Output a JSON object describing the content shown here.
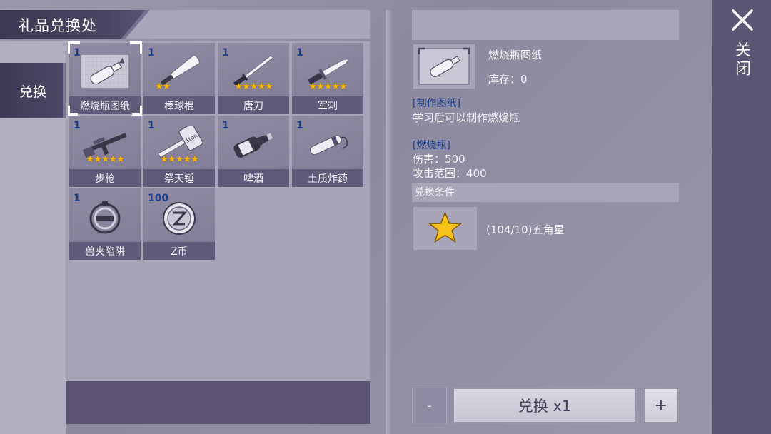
{
  "header": {
    "title": "礼品兑换处"
  },
  "tabs": [
    {
      "label": "兑换"
    }
  ],
  "items": [
    {
      "name": "燃烧瓶图纸",
      "count": "1",
      "stars": "",
      "icon": "blueprint-icon"
    },
    {
      "name": "棒球棍",
      "count": "1",
      "stars": "★★",
      "icon": "baseball-bat-icon"
    },
    {
      "name": "唐刀",
      "count": "1",
      "stars": "★★★★★",
      "icon": "tang-sword-icon"
    },
    {
      "name": "军刺",
      "count": "1",
      "stars": "★★★★★",
      "icon": "bayonet-icon"
    },
    {
      "name": "步枪",
      "count": "1",
      "stars": "★★★★★",
      "icon": "rifle-icon"
    },
    {
      "name": "祭天锤",
      "count": "1",
      "stars": "★★★★★",
      "icon": "hammer-icon"
    },
    {
      "name": "啤酒",
      "count": "1",
      "stars": "",
      "icon": "beer-bottle-icon"
    },
    {
      "name": "土质炸药",
      "count": "1",
      "stars": "",
      "icon": "dynamite-icon"
    },
    {
      "name": "兽夹陷阱",
      "count": "1",
      "stars": "",
      "icon": "bear-trap-icon"
    },
    {
      "name": "Z币",
      "count": "100",
      "stars": "",
      "icon": "z-coin-icon"
    }
  ],
  "detail": {
    "name": "燃烧瓶图纸",
    "stock": "库存：0",
    "section1_title": "[制作图纸]",
    "section1_text": "学习后可以制作燃烧瓶",
    "section2_title": "[燃烧瓶]",
    "damage": "伤害：500",
    "range": "攻击范围：400",
    "condition_title": "兑换条件",
    "condition_text": "(104/10)五角星",
    "condition_icon": "star-icon"
  },
  "controls": {
    "minus_label": "-",
    "exchange_label": "兑换 x1",
    "plus_label": "+"
  },
  "close": {
    "label": "关闭"
  },
  "colors": {
    "count_blue": "#1c3f8f",
    "star_gold": "#f5b700",
    "dark_panel": "#59536f"
  }
}
